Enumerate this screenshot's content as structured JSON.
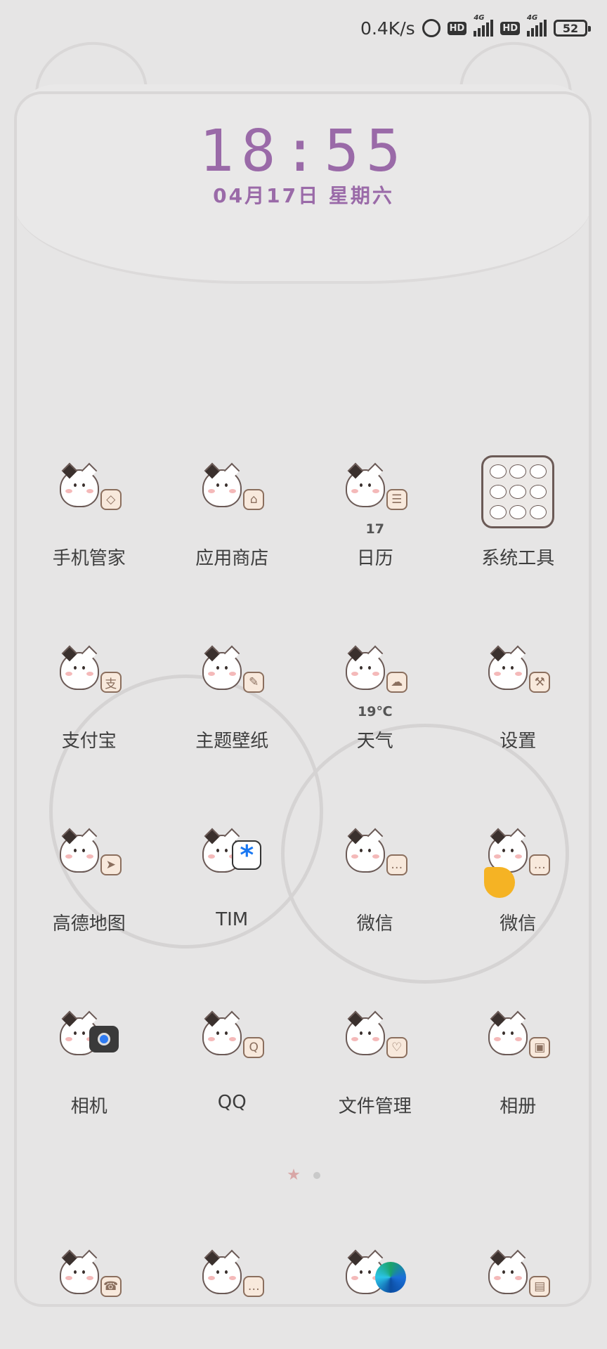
{
  "status_bar": {
    "net_speed": "0.4K/s",
    "hd_1": "HD",
    "hd_2": "HD",
    "network_1": "4G",
    "network_2": "4G",
    "battery": "52"
  },
  "clock": {
    "time": "18:55",
    "date": "04月17日  星期六"
  },
  "apps": [
    [
      {
        "label": "手机管家",
        "symbol": "◇"
      },
      {
        "label": "应用商店",
        "symbol": "⌂"
      },
      {
        "label": "日历",
        "symbol": "☰",
        "sub": "17"
      },
      {
        "label": "系统工具",
        "folder": true
      }
    ],
    [
      {
        "label": "支付宝",
        "symbol": "支"
      },
      {
        "label": "主题壁纸",
        "symbol": "✎"
      },
      {
        "label": "天气",
        "symbol": "☁",
        "sub": "19℃"
      },
      {
        "label": "设置",
        "symbol": "⚒"
      }
    ],
    [
      {
        "label": "高德地图",
        "symbol": "➤"
      },
      {
        "label": "TIM",
        "symbol": "*"
      },
      {
        "label": "微信",
        "symbol": "…"
      },
      {
        "label": "微信",
        "symbol": "…"
      }
    ],
    [
      {
        "label": "相机"
      },
      {
        "label": "QQ",
        "symbol": "Q"
      },
      {
        "label": "文件管理",
        "symbol": "♡"
      },
      {
        "label": "相册",
        "symbol": "▣"
      }
    ]
  ],
  "dock": [
    {
      "symbol": "☎"
    },
    {
      "symbol": "…"
    },
    {},
    {
      "symbol": "▤"
    }
  ],
  "page_indicator": {
    "current": 1,
    "total": 2
  }
}
